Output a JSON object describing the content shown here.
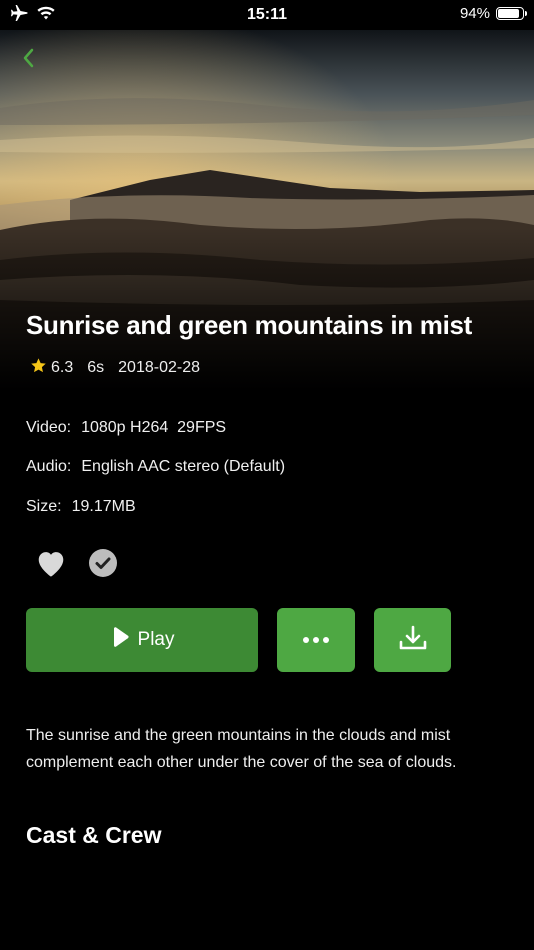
{
  "status_bar": {
    "time": "15:11",
    "battery_text": "94%",
    "battery_level": 0.94
  },
  "movie": {
    "title": "Sunrise and green mountains in mist",
    "rating": "6.3",
    "duration": "6s",
    "date": "2018-02-28"
  },
  "details": {
    "video_label": "Video:",
    "video_value": "1080p H264  29FPS",
    "audio_label": "Audio:",
    "audio_value": "English AAC stereo (Default)",
    "size_label": "Size:",
    "size_value": "19.17MB"
  },
  "actions": {
    "play_label": "Play"
  },
  "description": "The sunrise and the green mountains in the clouds and mist complement each other under the cover of the sea of clouds.",
  "section_title": "Cast & Crew",
  "colors": {
    "accent": "#4ea843",
    "play_bg": "#3d8a34",
    "star": "#f5c518"
  },
  "icons": [
    "airplane-icon",
    "wifi-icon",
    "back-chevron-icon",
    "star-icon",
    "heart-icon",
    "check-icon",
    "play-icon",
    "more-icon",
    "download-icon"
  ]
}
